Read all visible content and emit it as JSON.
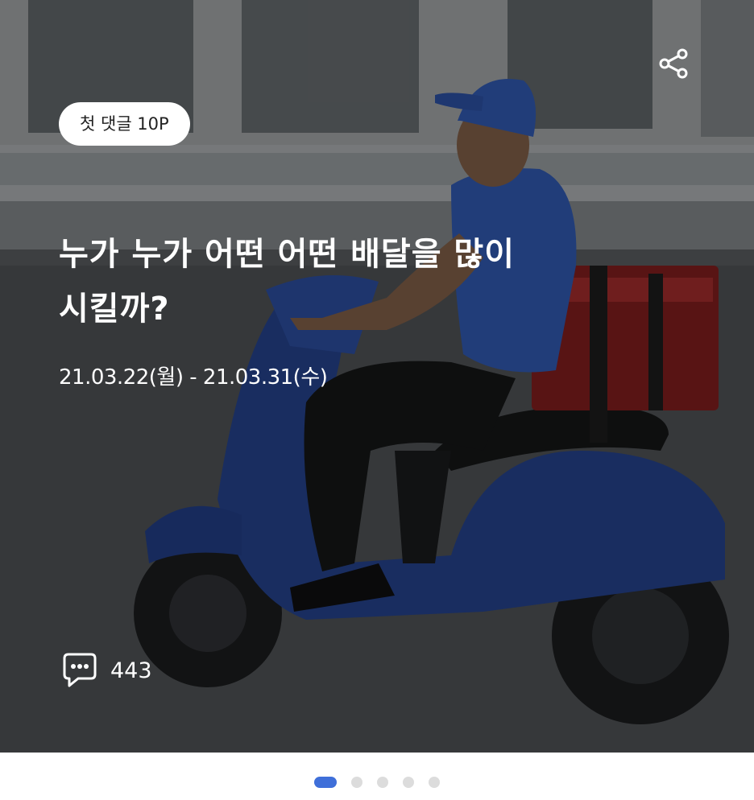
{
  "banner": {
    "badge": "첫 댓글 10P",
    "title_line1": "누가 누가 어떤 어떤 배달을 많이",
    "title_line2": "시킬까?",
    "period": "21.03.22(월) - 21.03.31(수)",
    "comment_count": "443",
    "image": "delivery-scooter-rider-photo"
  },
  "icons": {
    "share": "share-icon",
    "comment": "comment-bubble-icon"
  },
  "pagination": {
    "total": 5,
    "active_index": 0,
    "active_color": "#3f6fd9",
    "inactive_color": "#dcdcdc"
  }
}
